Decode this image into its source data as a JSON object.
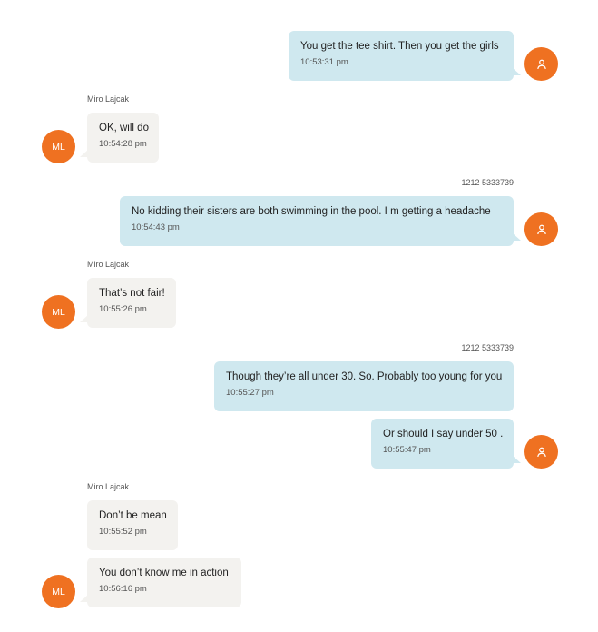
{
  "colors": {
    "outgoing_bubble": "#cfe8ef",
    "incoming_bubble": "#f3f2ef",
    "avatar": "#ef7121"
  },
  "icons": {
    "self_avatar": "user-icon"
  },
  "messages": [
    {
      "text": "You get the tee shirt.  Then you get the girls",
      "time": "10:53:31 pm"
    },
    {
      "sender": "Miro Lajcak",
      "avatar": "ML",
      "text": "OK, will do",
      "time": "10:54:28 pm"
    },
    {
      "sender": "1212 5333739",
      "text": "No kidding their sisters are both swimming in the pool.    I m getting a headache",
      "time": "10:54:43 pm"
    },
    {
      "sender": "Miro Lajcak",
      "avatar": "ML",
      "text": "That’s not fair!",
      "time": "10:55:26 pm"
    },
    {
      "sender": "1212 5333739",
      "text": "Though they’re all under 30. So. Probably too young for you",
      "time": "10:55:27 pm"
    },
    {
      "text": "Or should I say under 50 .",
      "time": "10:55:47 pm"
    },
    {
      "sender": "Miro Lajcak",
      "text": "Don’t be mean",
      "time": "10:55:52 pm"
    },
    {
      "avatar": "ML",
      "text": "You don’t know me in action",
      "time": "10:56:16 pm"
    }
  ]
}
